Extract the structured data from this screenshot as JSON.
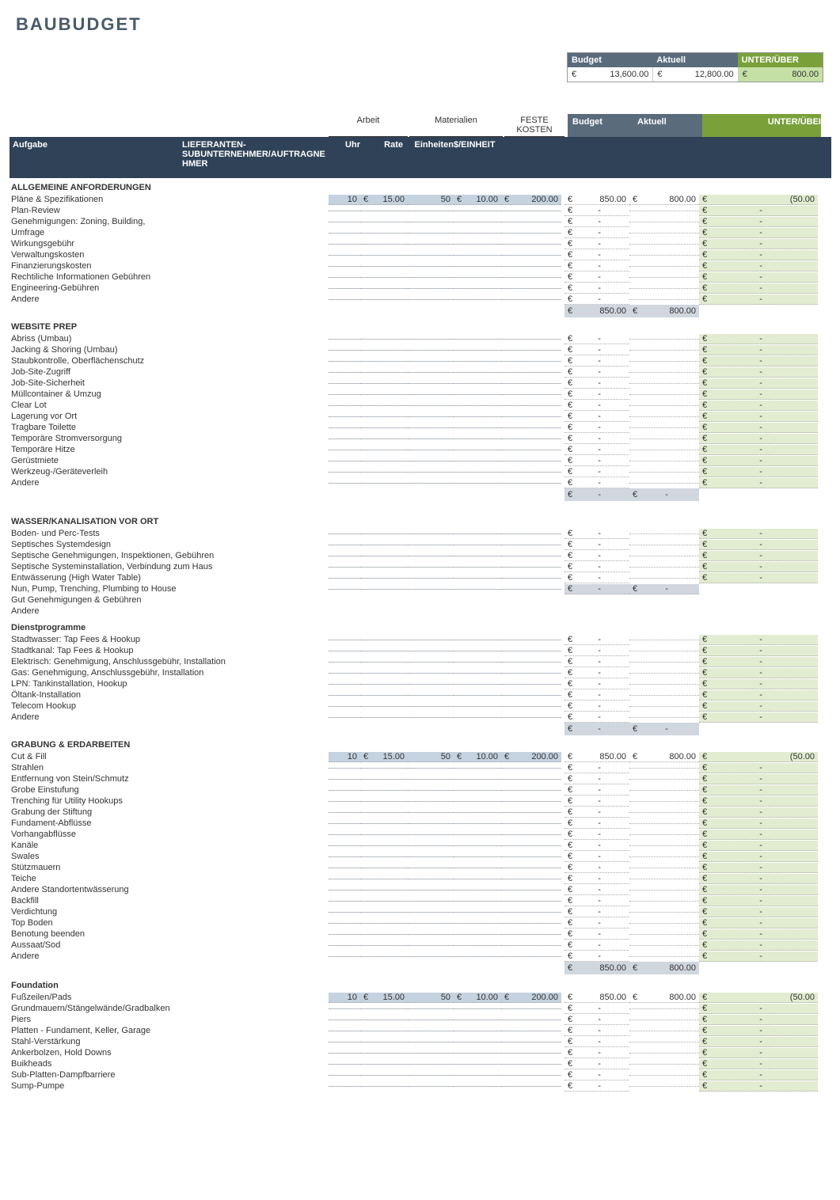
{
  "title": "BAUBUDGET",
  "summary": {
    "headers": {
      "budget": "Budget",
      "actual": "Aktuell",
      "variance": "UNTER/ÜBER"
    },
    "values": {
      "budget_cur": "€",
      "budget": "13,600.00",
      "actual_cur": "€",
      "actual": "12,800.00",
      "variance_cur": "€",
      "variance": "800.00"
    }
  },
  "groupHeaders": {
    "arbeit": "Arbeit",
    "materialien": "Materialien",
    "feste": "FESTE KOSTEN",
    "budget": "Budget",
    "aktuell": "Aktuell",
    "unter": "UNTER/ÜBEI"
  },
  "colHeaders": {
    "aufgabe": "Aufgabe",
    "lieferant": "LIEFERANTEN- SUBUNTERNEHMER/AUFTRAGNEHMER",
    "uhr": "Uhr",
    "rate": "Rate",
    "einheiten": "Einheiten",
    "unit": "$/EINHEIT"
  },
  "currency": "€",
  "sections": [
    {
      "title": "ALLGEMEINE ANFORDERUNGEN",
      "rows": [
        {
          "task": "Pläne & Spezifikationen",
          "uhr": "10",
          "rate": "15.00",
          "ein": "50",
          "unit": "10.00",
          "fk": "200.00",
          "bu": "850.00",
          "ak": "800.00",
          "unv": "(50.00"
        },
        {
          "task": "Plan-Review"
        },
        {
          "task": "Genehmigungen: Zoning, Building,"
        },
        {
          "task": "Umfrage"
        },
        {
          "task": "Wirkungsgebühr"
        },
        {
          "task": "Verwaltungskosten"
        },
        {
          "task": "Finanzierungskosten"
        },
        {
          "task": "Rechtiliche Informationen Gebühren"
        },
        {
          "task": "Engineering-Gebühren"
        },
        {
          "task": "Andere"
        }
      ],
      "total": {
        "bu": "850.00",
        "ak": "800.00"
      }
    },
    {
      "title": "WEBSITE PREP",
      "rows": [
        {
          "task": "Abriss (Umbau)"
        },
        {
          "task": "Jacking & Shoring (Umbau)"
        },
        {
          "task": "Staubkontrolle, Oberflächenschutz"
        },
        {
          "task": "Job-Site-Zugriff"
        },
        {
          "task": "Job-Site-Sicherheit"
        },
        {
          "task": "Müllcontainer & Umzug"
        },
        {
          "task": "Clear Lot"
        },
        {
          "task": "Lagerung vor Ort"
        },
        {
          "task": "Tragbare Toilette"
        },
        {
          "task": "Temporäre Stromversorgung"
        },
        {
          "task": "Temporäre Hitze"
        },
        {
          "task": "Gerüstmiete"
        },
        {
          "task": "Werkzeug-/Geräteverleih"
        },
        {
          "task": "Andere"
        }
      ],
      "total": {
        "bu": "-",
        "ak": "-"
      }
    },
    {
      "title": "WASSER/KANALISATION VOR ORT",
      "spaceBefore": true,
      "rows": [
        {
          "task": "Boden- und Perc-Tests"
        },
        {
          "task": "Septisches Systemdesign"
        },
        {
          "task": "Septische Genehmigungen, Inspektionen, Gebühren"
        },
        {
          "task": "Septische Systeminstallation, Verbindung zum Haus"
        },
        {
          "task": "Entwässerung (High Water Table)"
        },
        {
          "task": "Nun, Pump, Trenching, Plumbing to House",
          "noBudget": true,
          "total": {
            "bu": "-",
            "ak": "-"
          }
        },
        {
          "task": "Gut Genehmigungen & Gebühren",
          "plain": true
        },
        {
          "task": "Andere",
          "plain": true
        }
      ]
    },
    {
      "title": "Dienstprogramme",
      "sub": true,
      "rows": [
        {
          "task": "Stadtwasser: Tap Fees & Hookup"
        },
        {
          "task": "Stadtkanal: Tap Fees & Hookup"
        },
        {
          "task": "Elektrisch: Genehmigung, Anschlussgebühr, Installation"
        },
        {
          "task": "Gas: Genehmigung, Anschlussgebühr, Installation"
        },
        {
          "task": "LPN: Tankinstallation, Hookup"
        },
        {
          "task": "Öltank-Installation"
        },
        {
          "task": "Telecom Hookup"
        },
        {
          "task": "Andere"
        }
      ],
      "total": {
        "bu": "-",
        "ak": "-"
      }
    },
    {
      "title": "GRABUNG & ERDARBEITEN",
      "rows": [
        {
          "task": "Cut & Fill",
          "uhr": "10",
          "rate": "15.00",
          "ein": "50",
          "unit": "10.00",
          "fk": "200.00",
          "bu": "850.00",
          "ak": "800.00",
          "unv": "(50.00"
        },
        {
          "task": "Strahlen"
        },
        {
          "task": "Entfernung von Stein/Schmutz"
        },
        {
          "task": "Grobe Einstufung"
        },
        {
          "task": "Trenching für Utility Hookups"
        },
        {
          "task": "Grabung der Stiftung"
        },
        {
          "task": "Fundament-Abflüsse"
        },
        {
          "task": "Vorhangabflüsse"
        },
        {
          "task": "Kanäle"
        },
        {
          "task": "Swales"
        },
        {
          "task": "Stützmauern"
        },
        {
          "task": "Teiche"
        },
        {
          "task": "Andere Standortentwässerung"
        },
        {
          "task": "Backfill"
        },
        {
          "task": "Verdichtung"
        },
        {
          "task": "Top Boden"
        },
        {
          "task": "Benotung beenden"
        },
        {
          "task": "Aussaat/Sod"
        },
        {
          "task": "Andere"
        }
      ],
      "total": {
        "bu": "850.00",
        "ak": "800.00"
      }
    },
    {
      "title": "Foundation",
      "sub": true,
      "rows": [
        {
          "task": "Fußzeilen/Pads",
          "uhr": "10",
          "rate": "15.00",
          "ein": "50",
          "unit": "10.00",
          "fk": "200.00",
          "bu": "850.00",
          "ak": "800.00",
          "unv": "(50.00"
        },
        {
          "task": "Grundmauern/Stängelwände/Gradbalken"
        },
        {
          "task": "Piers"
        },
        {
          "task": "Platten - Fundament, Keller, Garage"
        },
        {
          "task": "Stahl-Verstärkung"
        },
        {
          "task": "Ankerbolzen, Hold Downs"
        },
        {
          "task": "Buikheads"
        },
        {
          "task": "Sub-Platten-Dampfbarriere"
        },
        {
          "task": "Sump-Pumpe"
        }
      ]
    }
  ]
}
